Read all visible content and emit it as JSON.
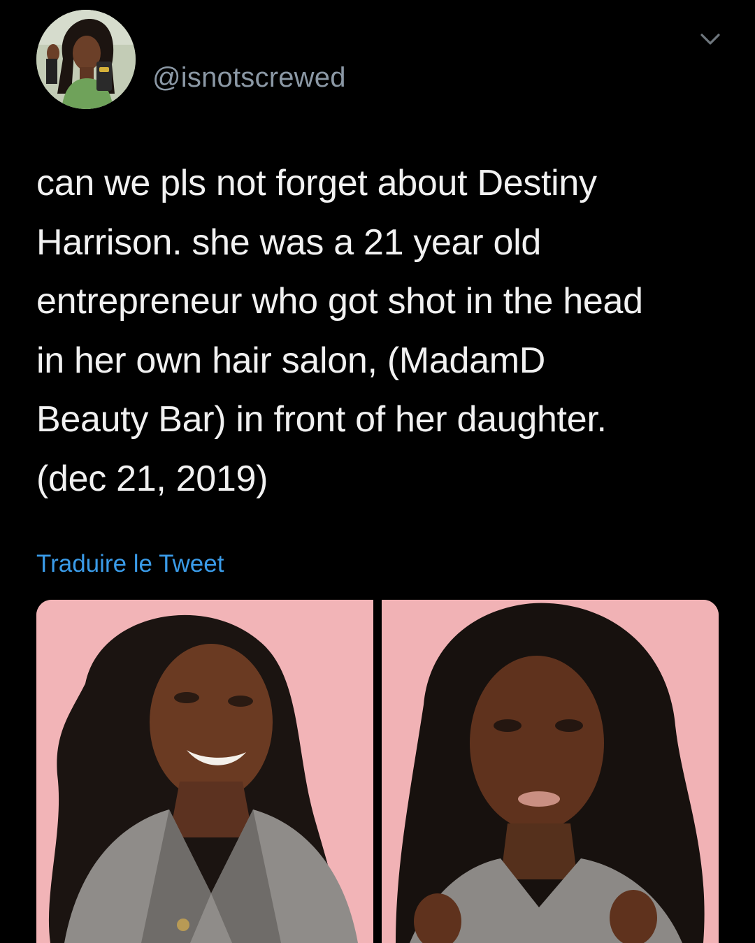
{
  "tweet": {
    "handle": "@isnotscrewed",
    "text": "can we pls not forget about Destiny\nHarrison. she was a 21 year old\nentrepreneur who got shot in the head\nin her own hair salon, (MadamD\nBeauty Bar) in front of her daughter.\n(dec 21, 2019)",
    "translate_label": "Traduire le Tweet"
  },
  "icons": {
    "menu": "chevron-down-icon"
  },
  "colors": {
    "background": "#000000",
    "text": "#f1f1f1",
    "handle": "#8b98a5",
    "link": "#3a9be8",
    "photo_background": "#f1b5b8"
  }
}
